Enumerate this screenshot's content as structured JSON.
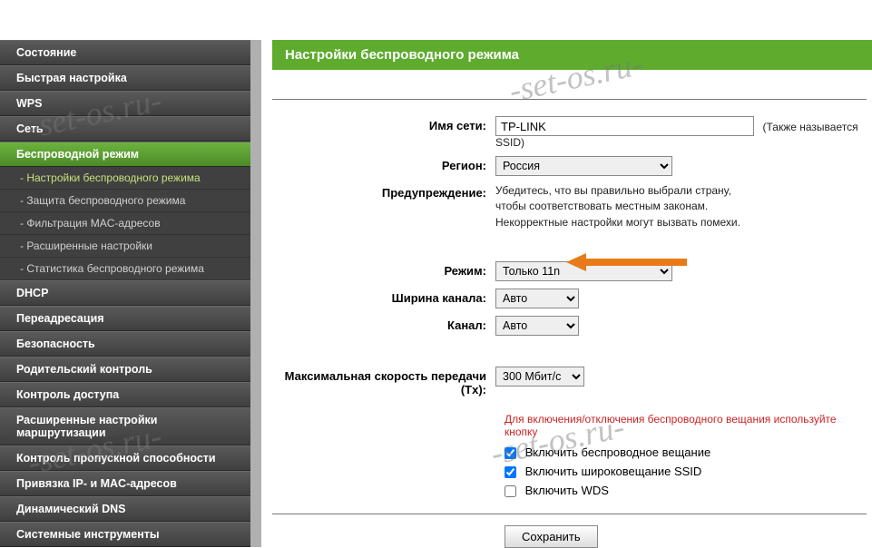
{
  "sidebar": {
    "items": [
      {
        "label": "Состояние"
      },
      {
        "label": "Быстрая настройка"
      },
      {
        "label": "WPS"
      },
      {
        "label": "Сеть"
      },
      {
        "label": "Беспроводной режим",
        "active": true
      },
      {
        "label": "DHCP"
      },
      {
        "label": "Переадресация"
      },
      {
        "label": "Безопасность"
      },
      {
        "label": "Родительский контроль"
      },
      {
        "label": "Контроль доступа"
      },
      {
        "label": "Расширенные настройки маршрутизации"
      },
      {
        "label": "Контроль пропускной способности"
      },
      {
        "label": "Привязка IP- и MAC-адресов"
      },
      {
        "label": "Динамический DNS"
      },
      {
        "label": "Системные инструменты"
      }
    ],
    "subitems": [
      {
        "label": "- Настройки беспроводного режима",
        "active": true
      },
      {
        "label": "- Защита беспроводного режима"
      },
      {
        "label": "- Фильтрация MAC-адресов"
      },
      {
        "label": "- Расширенные настройки"
      },
      {
        "label": "- Статистика беспроводного режима"
      }
    ]
  },
  "page": {
    "title": "Настройки беспроводного режима"
  },
  "form": {
    "ssid_label": "Имя сети:",
    "ssid_value": "TP-LINK",
    "ssid_hint": "(Также называется SSID)",
    "region_label": "Регион:",
    "region_value": "Россия",
    "warning_label": "Предупреждение:",
    "warning_text_1": "Убедитесь, что вы правильно выбрали страну,",
    "warning_text_2": "чтобы соответствовать местным законам.",
    "warning_text_3": "Некорректные настройки могут вызвать помехи.",
    "mode_label": "Режим:",
    "mode_value": "Только 11n",
    "width_label": "Ширина канала:",
    "width_value": "Авто",
    "channel_label": "Канал:",
    "channel_value": "Авто",
    "txrate_label": "Максимальная скорость передачи (Tx):",
    "txrate_value": "300 Мбит/с",
    "note": "Для включения/отключения беспроводного вещания используйте кнопку",
    "chk_broadcast": "Включить беспроводное вещание",
    "chk_ssid": "Включить широковещание SSID",
    "chk_wds": "Включить WDS",
    "save": "Сохранить"
  },
  "watermark": "-set-os.ru-"
}
